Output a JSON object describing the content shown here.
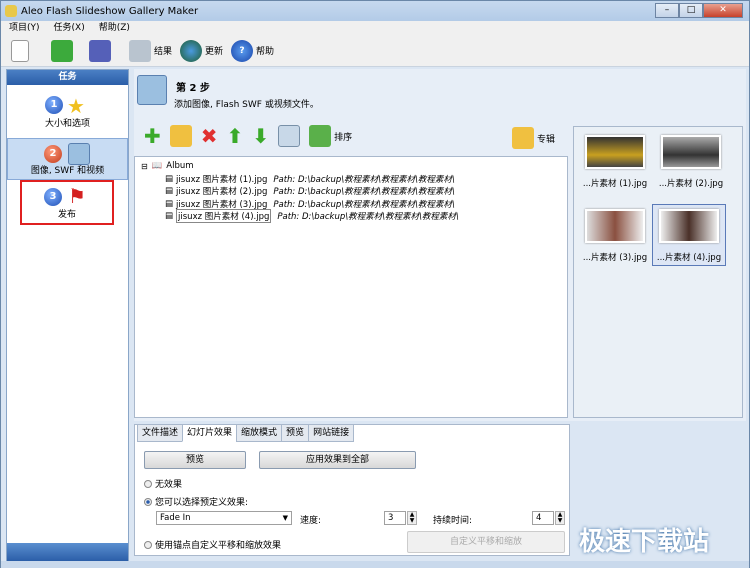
{
  "window": {
    "title": "Aleo Flash Slideshow Gallery Maker"
  },
  "menu": [
    "项目(Y)",
    "任务(X)",
    "帮助(Z)"
  ],
  "toolbar": {
    "results": "结果",
    "update": "更新",
    "help": "帮助"
  },
  "tasks": {
    "header": "任务",
    "items": [
      {
        "num": "1",
        "label": "大小和选项"
      },
      {
        "num": "2",
        "label": "图像, SWF 和视频"
      },
      {
        "num": "3",
        "label": "发布"
      }
    ]
  },
  "step": {
    "title": "第 2 步",
    "desc": "添加图像, Flash SWF 或视频文件。"
  },
  "actions": {
    "sort": "排序",
    "album": "专辑"
  },
  "tree": {
    "root": "Album",
    "files": [
      {
        "name": "jisuxz 图片素材 (1).jpg",
        "path": "Path: D:\\backup\\教程素材\\教程素材\\教程素材\\"
      },
      {
        "name": "jisuxz 图片素材 (2).jpg",
        "path": "Path: D:\\backup\\教程素材\\教程素材\\教程素材\\"
      },
      {
        "name": "jisuxz 图片素材 (3).jpg",
        "path": "Path: D:\\backup\\教程素材\\教程素材\\教程素材\\"
      },
      {
        "name": "jisuxz 图片素材 (4).jpg",
        "path": "Path: D:\\backup\\教程素材\\教程素材\\教程素材\\"
      }
    ]
  },
  "thumbs": [
    "...片素材 (1).jpg",
    "...片素材 (2).jpg",
    "...片素材 (3).jpg",
    "...片素材 (4).jpg"
  ],
  "tabs": [
    "文件描述",
    "幻灯片效果",
    "缩放模式",
    "预览",
    "网站链接"
  ],
  "effects": {
    "preview": "预览",
    "apply_all": "应用效果到全部",
    "no_effect": "无效果",
    "predefined": "您可以选择预定义效果:",
    "effect_value": "Fade In",
    "speed_label": "速度:",
    "speed": "3",
    "duration_label": "持续时间:",
    "duration": "4",
    "custom": "使用锚点自定义平移和缩放效果",
    "custom_btn": "自定义平移和缩放"
  },
  "watermark": "极速下载站"
}
